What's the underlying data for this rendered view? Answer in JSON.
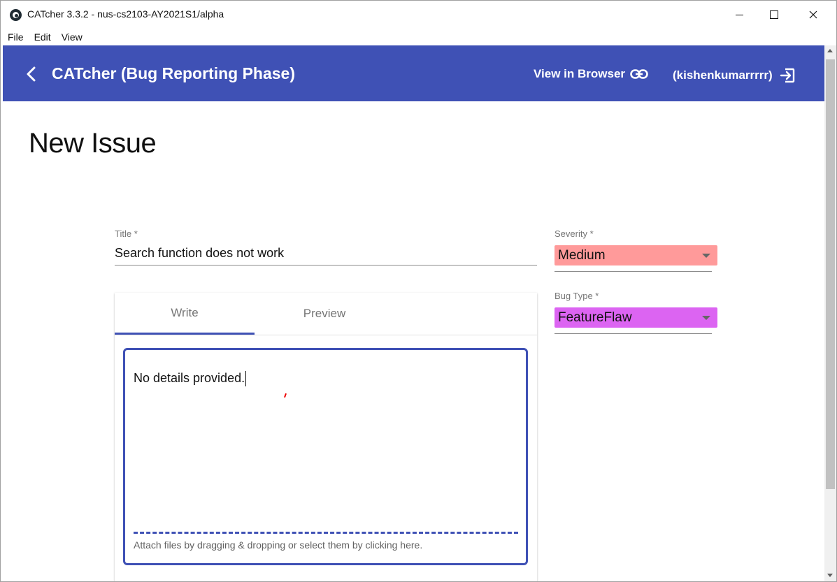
{
  "window": {
    "title": "CATcher 3.3.2 - nus-cs2103-AY2021S1/alpha",
    "menu": [
      "File",
      "Edit",
      "View"
    ]
  },
  "toolbar": {
    "app_title": "CATcher  (Bug Reporting Phase)",
    "view_in_browser": "View in Browser",
    "user": "(kishenkumarrrrr)"
  },
  "page": {
    "heading": "New Issue"
  },
  "form": {
    "title_label": "Title *",
    "title_value": "Search function does not work",
    "severity_label": "Severity *",
    "severity_value": "Medium",
    "severity_color": "#ff9a9a",
    "bug_type_label": "Bug Type *",
    "bug_type_value": "FeatureFlaw",
    "bug_type_color": "#dc64f2"
  },
  "editor": {
    "tabs": [
      "Write",
      "Preview"
    ],
    "active_tab": "Write",
    "content": "No details provided.",
    "attach_hint": "Attach files by dragging & dropping or select them by clicking here."
  },
  "colors": {
    "primary": "#3f51b5"
  }
}
